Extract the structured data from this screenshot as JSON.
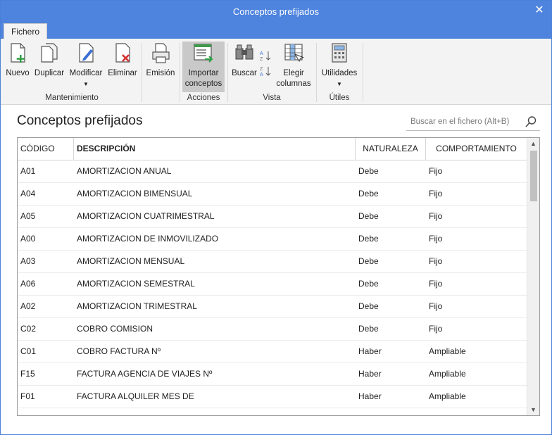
{
  "window": {
    "title": "Conceptos prefijados",
    "close_glyph": "✕"
  },
  "tabs": [
    {
      "label": "Fichero",
      "active": true
    }
  ],
  "ribbon": {
    "buttons": {
      "nuevo": {
        "label": "Nuevo",
        "icon": "new-document-icon"
      },
      "duplicar": {
        "label": "Duplicar",
        "icon": "duplicate-icon"
      },
      "modificar": {
        "label": "Modificar",
        "icon": "edit-document-icon"
      },
      "eliminar": {
        "label": "Eliminar",
        "icon": "delete-document-icon"
      },
      "emision": {
        "label": "Emisión",
        "icon": "printer-icon"
      },
      "importar": {
        "label": "Importar conceptos",
        "icon": "import-icon"
      },
      "buscar": {
        "label": "Buscar",
        "icon": "binoculars-icon"
      },
      "elegir": {
        "label": "Elegir columnas",
        "icon": "choose-columns-icon"
      },
      "utilidades": {
        "label": "Utilidades",
        "icon": "calculator-icon"
      }
    },
    "groups": {
      "mantenimiento": "Mantenimiento",
      "acciones": "Acciones",
      "vista": "Vista",
      "utiles": "Útiles"
    }
  },
  "page": {
    "title": "Conceptos prefijados"
  },
  "search": {
    "placeholder": "Buscar en el fichero (Alt+B)"
  },
  "table": {
    "headers": [
      "CÓDIGO",
      "DESCRIPCIÓN",
      "NATURALEZA",
      "COMPORTAMIENTO"
    ],
    "rows": [
      {
        "codigo": "A01",
        "descripcion": "AMORTIZACION ANUAL",
        "naturaleza": "Debe",
        "comportamiento": "Fijo"
      },
      {
        "codigo": "A04",
        "descripcion": "AMORTIZACION BIMENSUAL",
        "naturaleza": "Debe",
        "comportamiento": "Fijo"
      },
      {
        "codigo": "A05",
        "descripcion": "AMORTIZACION CUATRIMESTRAL",
        "naturaleza": "Debe",
        "comportamiento": "Fijo"
      },
      {
        "codigo": "A00",
        "descripcion": "AMORTIZACION DE INMOVILIZADO",
        "naturaleza": "Debe",
        "comportamiento": "Fijo"
      },
      {
        "codigo": "A03",
        "descripcion": "AMORTIZACION MENSUAL",
        "naturaleza": "Debe",
        "comportamiento": "Fijo"
      },
      {
        "codigo": "A06",
        "descripcion": "AMORTIZACION SEMESTRAL",
        "naturaleza": "Debe",
        "comportamiento": "Fijo"
      },
      {
        "codigo": "A02",
        "descripcion": "AMORTIZACION TRIMESTRAL",
        "naturaleza": "Debe",
        "comportamiento": "Fijo"
      },
      {
        "codigo": "C02",
        "descripcion": "COBRO COMISION",
        "naturaleza": "Debe",
        "comportamiento": "Fijo"
      },
      {
        "codigo": "C01",
        "descripcion": "COBRO FACTURA Nº",
        "naturaleza": "Haber",
        "comportamiento": "Ampliable"
      },
      {
        "codigo": "F15",
        "descripcion": "FACTURA AGENCIA DE VIAJES Nº",
        "naturaleza": "Haber",
        "comportamiento": "Ampliable"
      },
      {
        "codigo": "F01",
        "descripcion": "FACTURA ALQUILER MES DE",
        "naturaleza": "Haber",
        "comportamiento": "Ampliable"
      }
    ]
  },
  "colors": {
    "titlebar": "#4e83de",
    "ribbon_bg": "#f3f3f3",
    "active_button": "#c9c9c9",
    "accent_green": "#2ea043",
    "accent_red": "#d33030"
  }
}
